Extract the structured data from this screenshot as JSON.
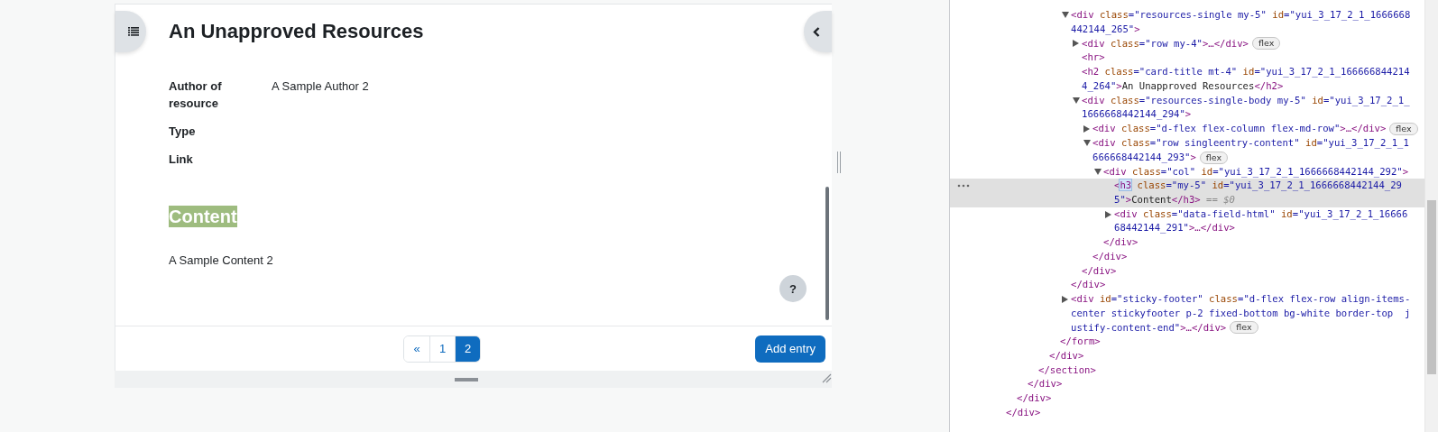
{
  "page": {
    "title": "An Unapproved Resources",
    "fields": [
      {
        "label": "Author of resource",
        "value": "A Sample Author 2"
      },
      {
        "label": "Type"
      },
      {
        "label": "Link"
      }
    ],
    "content_heading": {
      "text": "Content",
      "highlighted": true
    },
    "content": "A Sample Content 2",
    "help_button": "?",
    "pagination": [
      {
        "label": "«",
        "selected": false
      },
      {
        "label": "1",
        "selected": false
      },
      {
        "label": "2",
        "selected": true
      }
    ],
    "add_button": "Add entry"
  },
  "devtools": {
    "tree": [
      {
        "close": [
          {
            "kind": "tag",
            "text": "</div>"
          }
        ],
        "children": [
          {
            "close": [
              {
                "kind": "tag",
                "text": "</div>"
              }
            ],
            "children": [
              {
                "close": [
                  {
                    "kind": "tag",
                    "text": "</div>"
                  }
                ],
                "children": [
                  {
                    "close": [
                      {
                        "kind": "tag",
                        "text": "</section>"
                      }
                    ],
                    "children": [
                      {
                        "close": [
                          {
                            "kind": "tag",
                            "text": "</div>"
                          }
                        ],
                        "children": [
                          {
                            "close": [
                              {
                                "kind": "tag",
                                "text": "</form>"
                              }
                            ],
                            "children": [
                              {
                                "selected": false,
                                "expanded": true,
                                "lines": [
                                  [
                                    {
                                      "kind": "tag",
                                      "text": "<div"
                                    },
                                    {
                                      "kind": "attr",
                                      "text": " class"
                                    },
                                    {
                                      "kind": "value",
                                      "text": "=\"resources-single my-5\""
                                    },
                                    {
                                      "kind": "attr",
                                      "text": " id"
                                    },
                                    {
                                      "kind": "value",
                                      "text": "=\"yui_3_17_2_1_1666668"
                                    }
                                  ],
                                  [
                                    {
                                      "kind": "value",
                                      "text": "442144_265\""
                                    },
                                    {
                                      "kind": "tag",
                                      "text": ">"
                                    }
                                  ]
                                ],
                                "close": [
                                  {
                                    "kind": "tag",
                                    "text": "</div>"
                                  }
                                ],
                                "children": [
                                  {
                                    "selected": false,
                                    "expanded": false,
                                    "badge": "flex",
                                    "lines": [
                                      [
                                        {
                                          "kind": "tag",
                                          "text": "<div"
                                        },
                                        {
                                          "kind": "attr",
                                          "text": " class"
                                        },
                                        {
                                          "kind": "value",
                                          "text": "=\"row my-4\""
                                        },
                                        {
                                          "kind": "tag",
                                          "text": ">…</div>"
                                        }
                                      ]
                                    ]
                                  },
                                  {
                                    "selected": false,
                                    "lines": [
                                      [
                                        {
                                          "kind": "tag",
                                          "text": "<hr>"
                                        }
                                      ]
                                    ]
                                  },
                                  {
                                    "selected": false,
                                    "lines": [
                                      [
                                        {
                                          "kind": "tag",
                                          "text": "<h2"
                                        },
                                        {
                                          "kind": "attr",
                                          "text": " class"
                                        },
                                        {
                                          "kind": "value",
                                          "text": "=\"card-title mt-4\""
                                        },
                                        {
                                          "kind": "attr",
                                          "text": " id"
                                        },
                                        {
                                          "kind": "value",
                                          "text": "=\"yui_3_17_2_1_166666844214"
                                        }
                                      ],
                                      [
                                        {
                                          "kind": "value",
                                          "text": "4_264\""
                                        },
                                        {
                                          "kind": "tag",
                                          "text": ">"
                                        },
                                        {
                                          "kind": "text",
                                          "text": "An Unapproved Resources"
                                        },
                                        {
                                          "kind": "tag",
                                          "text": "</h2>"
                                        }
                                      ]
                                    ]
                                  },
                                  {
                                    "selected": false,
                                    "expanded": true,
                                    "lines": [
                                      [
                                        {
                                          "kind": "tag",
                                          "text": "<div"
                                        },
                                        {
                                          "kind": "attr",
                                          "text": " class"
                                        },
                                        {
                                          "kind": "value",
                                          "text": "=\"resources-single-body my-5\""
                                        },
                                        {
                                          "kind": "attr",
                                          "text": " id"
                                        },
                                        {
                                          "kind": "value",
                                          "text": "=\"yui_3_17_2_1_"
                                        }
                                      ],
                                      [
                                        {
                                          "kind": "value",
                                          "text": "1666668442144_294\""
                                        },
                                        {
                                          "kind": "tag",
                                          "text": ">"
                                        }
                                      ]
                                    ],
                                    "close": [
                                      {
                                        "kind": "tag",
                                        "text": "</div>"
                                      }
                                    ],
                                    "children": [
                                      {
                                        "selected": false,
                                        "expanded": false,
                                        "badge": "flex",
                                        "lines": [
                                          [
                                            {
                                              "kind": "tag",
                                              "text": "<div"
                                            },
                                            {
                                              "kind": "attr",
                                              "text": " class"
                                            },
                                            {
                                              "kind": "value",
                                              "text": "=\"d-flex flex-column flex-md-row\""
                                            },
                                            {
                                              "kind": "tag",
                                              "text": ">…</div>"
                                            }
                                          ]
                                        ]
                                      },
                                      {
                                        "selected": false,
                                        "expanded": true,
                                        "badge": "flex",
                                        "lines": [
                                          [
                                            {
                                              "kind": "tag",
                                              "text": "<div"
                                            },
                                            {
                                              "kind": "attr",
                                              "text": " class"
                                            },
                                            {
                                              "kind": "value",
                                              "text": "=\"row singleentry-content\""
                                            },
                                            {
                                              "kind": "attr",
                                              "text": " id"
                                            },
                                            {
                                              "kind": "value",
                                              "text": "=\"yui_3_17_2_1_1"
                                            }
                                          ],
                                          [
                                            {
                                              "kind": "value",
                                              "text": "666668442144_293\""
                                            },
                                            {
                                              "kind": "tag",
                                              "text": ">"
                                            }
                                          ]
                                        ],
                                        "close": [
                                          {
                                            "kind": "tag",
                                            "text": "</div>"
                                          }
                                        ],
                                        "children": [
                                          {
                                            "selected": false,
                                            "expanded": true,
                                            "lines": [
                                              [
                                                {
                                                  "kind": "tag",
                                                  "text": "<div"
                                                },
                                                {
                                                  "kind": "attr",
                                                  "text": " class"
                                                },
                                                {
                                                  "kind": "value",
                                                  "text": "=\"col\""
                                                },
                                                {
                                                  "kind": "attr",
                                                  "text": " id"
                                                },
                                                {
                                                  "kind": "value",
                                                  "text": "=\"yui_3_17_2_1_1666668442144_292\""
                                                },
                                                {
                                                  "kind": "tag",
                                                  "text": ">"
                                                }
                                              ]
                                            ],
                                            "close": [
                                              {
                                                "kind": "tag",
                                                "text": "</div>"
                                              }
                                            ],
                                            "children": [
                                              {
                                                "selected": true,
                                                "lines": [
                                                  [
                                                    {
                                                      "kind": "tag",
                                                      "text": "<"
                                                    },
                                                    {
                                                      "kind": "tag-selected",
                                                      "text": "h3"
                                                    },
                                                    {
                                                      "kind": "attr",
                                                      "text": " class"
                                                    },
                                                    {
                                                      "kind": "value",
                                                      "text": "=\"my-5\""
                                                    },
                                                    {
                                                      "kind": "attr",
                                                      "text": " id"
                                                    },
                                                    {
                                                      "kind": "value",
                                                      "text": "=\"yui_3_17_2_1_1666668442144_29"
                                                    }
                                                  ],
                                                  [
                                                    {
                                                      "kind": "value",
                                                      "text": "5\""
                                                    },
                                                    {
                                                      "kind": "tag",
                                                      "text": ">"
                                                    },
                                                    {
                                                      "kind": "text",
                                                      "text": "Content"
                                                    },
                                                    {
                                                      "kind": "tag",
                                                      "text": "</h3>"
                                                    },
                                                    {
                                                      "kind": "hint",
                                                      "text": " == $0"
                                                    }
                                                  ]
                                                ]
                                              },
                                              {
                                                "selected": false,
                                                "expanded": false,
                                                "lines": [
                                                  [
                                                    {
                                                      "kind": "tag",
                                                      "text": "<div"
                                                    },
                                                    {
                                                      "kind": "attr",
                                                      "text": " class"
                                                    },
                                                    {
                                                      "kind": "value",
                                                      "text": "=\"data-field-html\""
                                                    },
                                                    {
                                                      "kind": "attr",
                                                      "text": " id"
                                                    },
                                                    {
                                                      "kind": "value",
                                                      "text": "=\"yui_3_17_2_1_16666"
                                                    }
                                                  ],
                                                  [
                                                    {
                                                      "kind": "value",
                                                      "text": "68442144_291\""
                                                    },
                                                    {
                                                      "kind": "tag",
                                                      "text": ">…</div>"
                                                    }
                                                  ]
                                                ]
                                              }
                                            ]
                                          }
                                        ]
                                      }
                                    ]
                                  }
                                ]
                              },
                              {
                                "selected": false,
                                "expanded": false,
                                "badge": "flex",
                                "lines": [
                                  [
                                    {
                                      "kind": "tag",
                                      "text": "<div"
                                    },
                                    {
                                      "kind": "attr",
                                      "text": " id"
                                    },
                                    {
                                      "kind": "value",
                                      "text": "=\"sticky-footer\""
                                    },
                                    {
                                      "kind": "attr",
                                      "text": " class"
                                    },
                                    {
                                      "kind": "value",
                                      "text": "=\"d-flex flex-row align-items-"
                                    }
                                  ],
                                  [
                                    {
                                      "kind": "value",
                                      "text": "center stickyfooter p-2 fixed-bottom bg-white border-top  j"
                                    }
                                  ],
                                  [
                                    {
                                      "kind": "value",
                                      "text": "ustify-content-end\""
                                    },
                                    {
                                      "kind": "tag",
                                      "text": ">…</div>"
                                    }
                                  ]
                                ]
                              }
                            ]
                          }
                        ]
                      }
                    ]
                  }
                ]
              }
            ]
          }
        ]
      }
    ]
  }
}
